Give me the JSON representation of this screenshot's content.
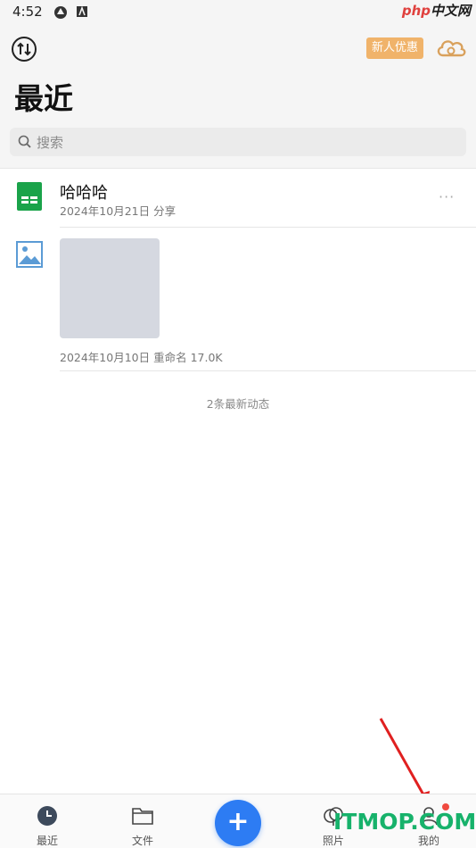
{
  "status_bar": {
    "time": "4:52"
  },
  "watermark_top": {
    "php": "php",
    "site": "中文网"
  },
  "header": {
    "promo_label": "新人优惠",
    "title": "最近"
  },
  "search": {
    "placeholder": "搜索"
  },
  "files": [
    {
      "name": "哈哈哈",
      "meta": "2024年10月21日  分享",
      "more": "···",
      "type": "spreadsheet"
    },
    {
      "meta": "2024年10月10日  重命名  17.0K",
      "type": "image"
    }
  ],
  "activity": {
    "count_text": "2条最新动态"
  },
  "bottom_nav": {
    "items": [
      {
        "label": "最近",
        "icon": "clock-icon"
      },
      {
        "label": "文件",
        "icon": "folder-icon"
      },
      {
        "label": "照片",
        "icon": "photos-icon"
      },
      {
        "label": "我的",
        "icon": "person-icon"
      }
    ],
    "fab_label": "+"
  },
  "watermark_bottom": {
    "text": "ITMOP.COM"
  },
  "colors": {
    "accent": "#2d7cf3",
    "sheet_green": "#1aa34a",
    "promo": "#f0b36a",
    "notify": "#f04a40",
    "watermark": "#17b26b"
  }
}
